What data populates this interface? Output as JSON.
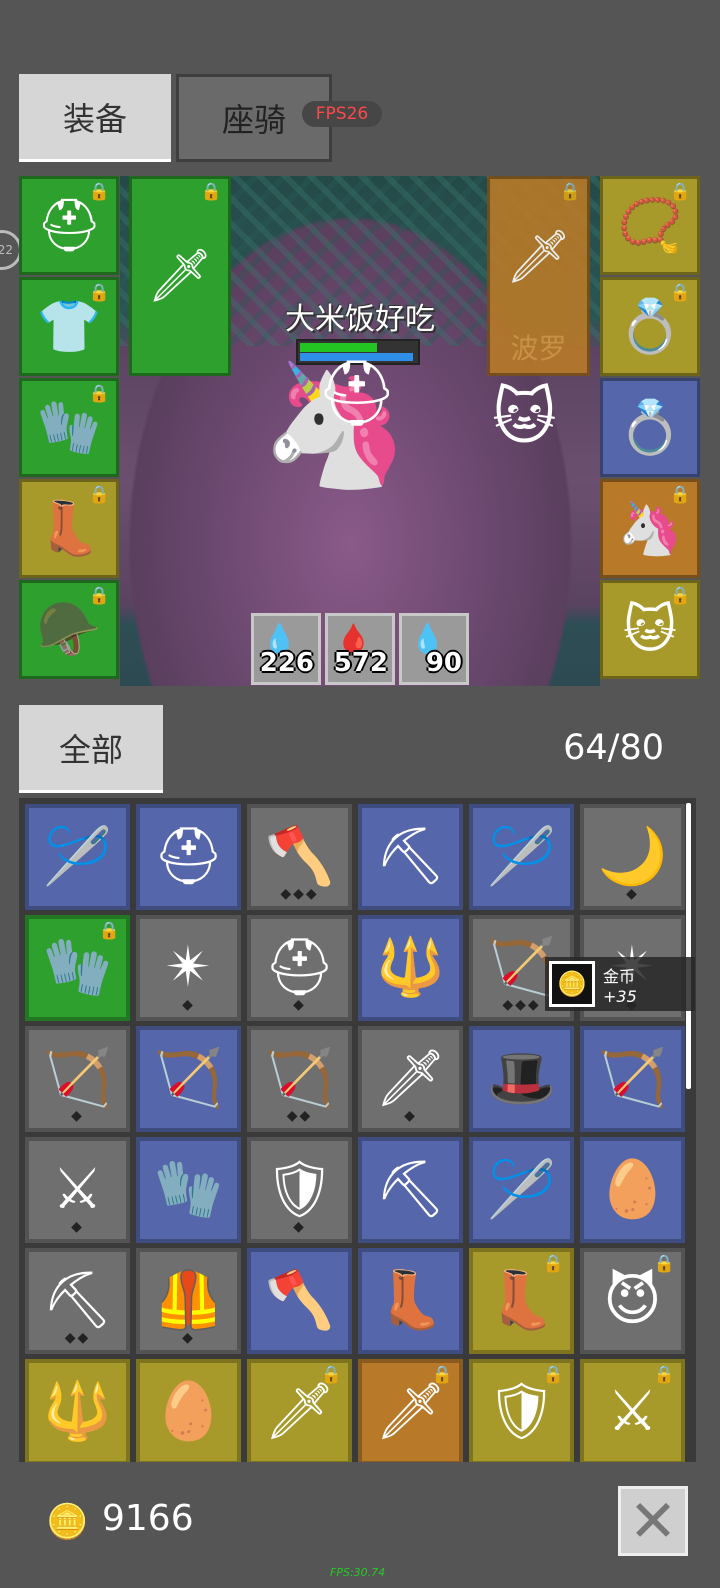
{
  "tabs": {
    "equip": "装备",
    "mount": "座骑"
  },
  "fps_badge": "FPS26",
  "side_bubble": "22",
  "player": {
    "name": "大米饭好吃",
    "hp_fraction": 0.66,
    "mp_fraction": 0.97
  },
  "pet_slot_label": "波罗",
  "stats": [
    {
      "icon": "water-drop-icon",
      "value": "226",
      "color": "#4fb3c9"
    },
    {
      "icon": "red-drop-icon",
      "value": "572",
      "color": "#e03030"
    },
    {
      "icon": "blue-drop-icon",
      "value": "90",
      "color": "#2f7de0"
    }
  ],
  "left_equipment": [
    {
      "name": "gold-helmet",
      "icon": "⛑",
      "color": "#2ea02e",
      "locked": true
    },
    {
      "name": "blue-armor",
      "icon": "👕",
      "color": "#2ea02e",
      "locked": true
    },
    {
      "name": "purple-glove",
      "icon": "🧤",
      "color": "#2ea02e",
      "locked": true
    },
    {
      "name": "brown-boots",
      "icon": "👢",
      "color": "#a89a2a",
      "locked": true
    },
    {
      "name": "dark-cape",
      "icon": "🪖",
      "color": "#2ea02e",
      "locked": true
    }
  ],
  "weapon_slot": {
    "name": "purple-sword",
    "icon": "🗡",
    "locked": true
  },
  "pet_slot": {
    "name": "orange-sword",
    "icon": "🗡",
    "locked": true
  },
  "right_equipment": [
    {
      "name": "red-amulet",
      "icon": "📿",
      "color": "#a89a2a",
      "locked": true
    },
    {
      "name": "ruby-ring",
      "icon": "💍",
      "color": "#a89a2a",
      "locked": true
    },
    {
      "name": "ruby-ring-blue",
      "icon": "💍",
      "color": "#5566aa",
      "locked": false
    },
    {
      "name": "unicorn-mount",
      "icon": "🦄",
      "color": "#b87a28",
      "locked": true
    },
    {
      "name": "cat-pet",
      "icon": "🐱",
      "color": "#a89a2a",
      "locked": true
    }
  ],
  "filter": {
    "all": "全部"
  },
  "inventory_count": "64/80",
  "inventory": [
    {
      "icon": "🪡",
      "color": "#5566aa",
      "locked": false,
      "dia": ""
    },
    {
      "icon": "⛑",
      "color": "#5566aa",
      "locked": false,
      "dia": ""
    },
    {
      "icon": "🪓",
      "color": "#6f6f6f",
      "locked": false,
      "dia": "◆◆◆"
    },
    {
      "icon": "⛏",
      "color": "#5566aa",
      "locked": false,
      "dia": ""
    },
    {
      "icon": "🪡",
      "color": "#5566aa",
      "locked": false,
      "dia": ""
    },
    {
      "icon": "🌙",
      "color": "#6f6f6f",
      "locked": false,
      "dia": "◆"
    },
    {
      "icon": "🧤",
      "color": "#2ea02e",
      "locked": true,
      "dia": ""
    },
    {
      "icon": "✴",
      "color": "#6f6f6f",
      "locked": false,
      "dia": "◆"
    },
    {
      "icon": "⛑",
      "color": "#6f6f6f",
      "locked": false,
      "dia": "◆"
    },
    {
      "icon": "🔱",
      "color": "#5566aa",
      "locked": false,
      "dia": ""
    },
    {
      "icon": "🏹",
      "color": "#6f6f6f",
      "locked": false,
      "dia": "◆◆◆"
    },
    {
      "icon": "✴",
      "color": "#6f6f6f",
      "locked": false,
      "dia": "◆"
    },
    {
      "icon": "🏹",
      "color": "#6f6f6f",
      "locked": false,
      "dia": "◆"
    },
    {
      "icon": "🏹",
      "color": "#5566aa",
      "locked": false,
      "dia": ""
    },
    {
      "icon": "🏹",
      "color": "#6f6f6f",
      "locked": false,
      "dia": "◆◆"
    },
    {
      "icon": "🗡",
      "color": "#6f6f6f",
      "locked": false,
      "dia": "◆"
    },
    {
      "icon": "🎩",
      "color": "#5566aa",
      "locked": false,
      "dia": ""
    },
    {
      "icon": "🏹",
      "color": "#5566aa",
      "locked": false,
      "dia": ""
    },
    {
      "icon": "⚔",
      "color": "#6f6f6f",
      "locked": false,
      "dia": "◆"
    },
    {
      "icon": "🧤",
      "color": "#5566aa",
      "locked": false,
      "dia": ""
    },
    {
      "icon": "🛡",
      "color": "#6f6f6f",
      "locked": false,
      "dia": "◆"
    },
    {
      "icon": "⛏",
      "color": "#5566aa",
      "locked": false,
      "dia": ""
    },
    {
      "icon": "🪡",
      "color": "#5566aa",
      "locked": false,
      "dia": ""
    },
    {
      "icon": "🥚",
      "color": "#5566aa",
      "locked": false,
      "dia": ""
    },
    {
      "icon": "⛏",
      "color": "#6f6f6f",
      "locked": false,
      "dia": "◆◆"
    },
    {
      "icon": "🦺",
      "color": "#6f6f6f",
      "locked": false,
      "dia": "◆"
    },
    {
      "icon": "🪓",
      "color": "#5566aa",
      "locked": false,
      "dia": ""
    },
    {
      "icon": "👢",
      "color": "#5566aa",
      "locked": false,
      "dia": ""
    },
    {
      "icon": "👢",
      "color": "#a89a2a",
      "locked": true,
      "dia": ""
    },
    {
      "icon": "😈",
      "color": "#6f6f6f",
      "locked": true,
      "dia": ""
    },
    {
      "icon": "🔱",
      "color": "#a89a2a",
      "locked": false,
      "dia": ""
    },
    {
      "icon": "🥚",
      "color": "#a89a2a",
      "locked": false,
      "dia": ""
    },
    {
      "icon": "🗡",
      "color": "#a89a2a",
      "locked": true,
      "dia": ""
    },
    {
      "icon": "🗡",
      "color": "#b87a28",
      "locked": true,
      "dia": ""
    },
    {
      "icon": "🛡",
      "color": "#a89a2a",
      "locked": true,
      "dia": ""
    },
    {
      "icon": "⚔",
      "color": "#a89a2a",
      "locked": true,
      "dia": ""
    }
  ],
  "tooltip": {
    "name": "金币",
    "amount": "+35",
    "icon": "gold-coins-icon"
  },
  "gold": {
    "amount": "9166",
    "icon": "gold-coins-icon"
  },
  "fps_bottom": "FPS:30.74",
  "lock_glyph": "🔒"
}
